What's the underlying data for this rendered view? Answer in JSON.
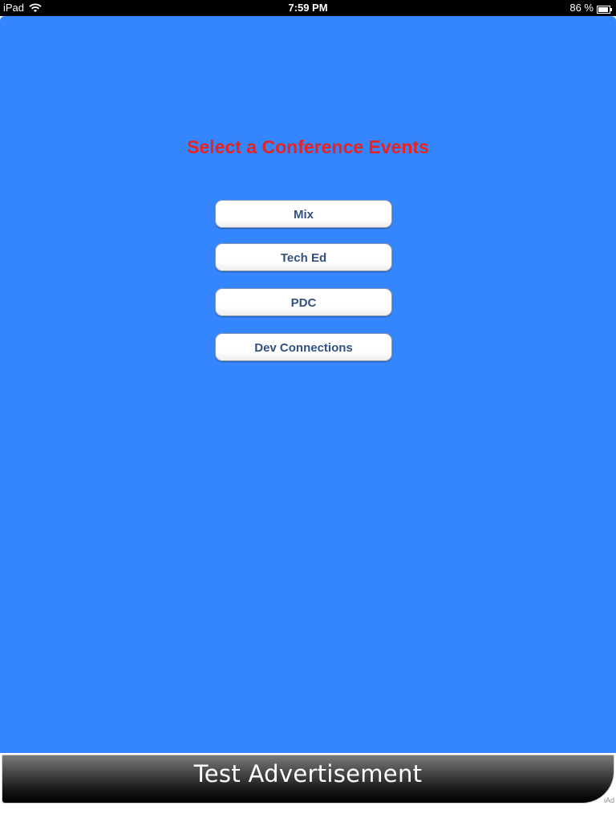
{
  "status_bar": {
    "carrier": "iPad",
    "time": "7:59 PM",
    "battery": "86 %",
    "icons": [
      "wifi-icon",
      "battery-icon"
    ]
  },
  "main": {
    "background_color": "#3485fe",
    "title": "Select a Conference Events",
    "title_color": "#e8231f",
    "events": [
      {
        "label": "Mix"
      },
      {
        "label": "Tech Ed"
      },
      {
        "label": "PDC"
      },
      {
        "label": "Dev Connections"
      }
    ]
  },
  "ad": {
    "text": "Test Advertisement",
    "provider_label": "iAd"
  }
}
